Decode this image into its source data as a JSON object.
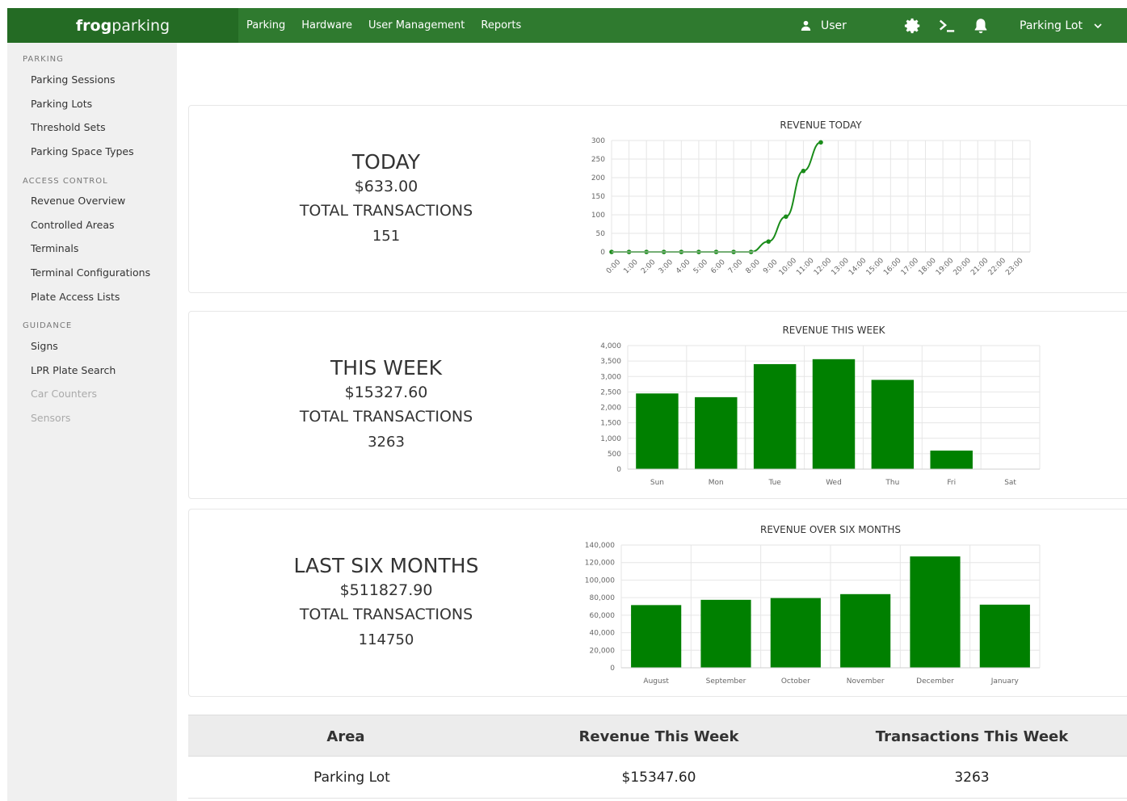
{
  "brand": {
    "bold": "frog",
    "rest": "parking"
  },
  "nav": [
    "Parking",
    "Hardware",
    "User Management",
    "Reports"
  ],
  "user": {
    "label": "User",
    "icon": "user-icon"
  },
  "header_icons": [
    "gear-icon",
    "terminal-icon",
    "bell-icon"
  ],
  "lot_selector": {
    "label": "Parking Lot",
    "icon": "chevron-down-icon"
  },
  "colors": {
    "header": "#2f7a2f",
    "brand_bg": "#246b24",
    "sidebar": "#f0f0f0",
    "bar": "#008000",
    "line": "#1a8c1a"
  },
  "sidebar": {
    "parking": {
      "title": "PARKING",
      "items": [
        "Parking Sessions",
        "Parking Lots",
        "Threshold Sets",
        "Parking Space Types"
      ]
    },
    "access": {
      "title": "ACCESS CONTROL",
      "items": [
        "Revenue Overview",
        "Controlled Areas",
        "Terminals",
        "Terminal Configurations",
        "Plate Access Lists"
      ]
    },
    "guidance": {
      "title": "GUIDANCE",
      "items": [
        "Signs",
        "LPR Plate Search",
        "Car Counters",
        "Sensors"
      ]
    }
  },
  "cards": [
    {
      "period": "TODAY",
      "amount": "$633.00",
      "label": "TOTAL TRANSACTIONS",
      "count": "151"
    },
    {
      "period": "THIS WEEK",
      "amount": "$15327.60",
      "label": "TOTAL TRANSACTIONS",
      "count": "3263"
    },
    {
      "period": "LAST SIX MONTHS",
      "amount": "$511827.90",
      "label": "TOTAL TRANSACTIONS",
      "count": "114750"
    }
  ],
  "chart_data": [
    {
      "type": "line",
      "title": "REVENUE TODAY",
      "x": [
        "0:00",
        "1:00",
        "2:00",
        "3:00",
        "4:00",
        "5:00",
        "6:00",
        "7:00",
        "8:00",
        "9:00",
        "10:00",
        "11:00",
        "12:00",
        "13:00",
        "14:00",
        "15:00",
        "16:00",
        "17:00",
        "18:00",
        "19:00",
        "20:00",
        "21:00",
        "22:00",
        "23:00"
      ],
      "values": [
        0,
        0,
        0,
        0,
        0,
        0,
        0,
        0,
        0,
        28,
        95,
        218,
        295
      ],
      "yticks": [
        "0",
        "50",
        "100",
        "150",
        "200",
        "250",
        "300"
      ],
      "ylim": [
        0,
        300
      ],
      "grid": true
    },
    {
      "type": "bar",
      "title": "REVENUE THIS WEEK",
      "categories": [
        "Sun",
        "Mon",
        "Tue",
        "Wed",
        "Thu",
        "Fri",
        "Sat"
      ],
      "values": [
        2450,
        2330,
        3400,
        3560,
        2890,
        600,
        0
      ],
      "yticks": [
        "0",
        "500",
        "1,000",
        "1,500",
        "2,000",
        "2,500",
        "3,000",
        "3,500",
        "4,000"
      ],
      "ylim": [
        0,
        4000
      ],
      "grid": true
    },
    {
      "type": "bar",
      "title": "REVENUE OVER SIX MONTHS",
      "categories": [
        "August",
        "September",
        "October",
        "November",
        "December",
        "January"
      ],
      "values": [
        71500,
        77500,
        79500,
        84000,
        127000,
        72000
      ],
      "yticks": [
        "0",
        "20,000",
        "40,000",
        "60,000",
        "80,000",
        "100,000",
        "120,000",
        "140,000"
      ],
      "ylim": [
        0,
        140000
      ],
      "grid": true
    }
  ],
  "table": {
    "headers": [
      "Area",
      "Revenue This Week",
      "Transactions This Week"
    ],
    "rows": [
      [
        "Parking Lot",
        "$15347.60",
        "3263"
      ]
    ]
  }
}
